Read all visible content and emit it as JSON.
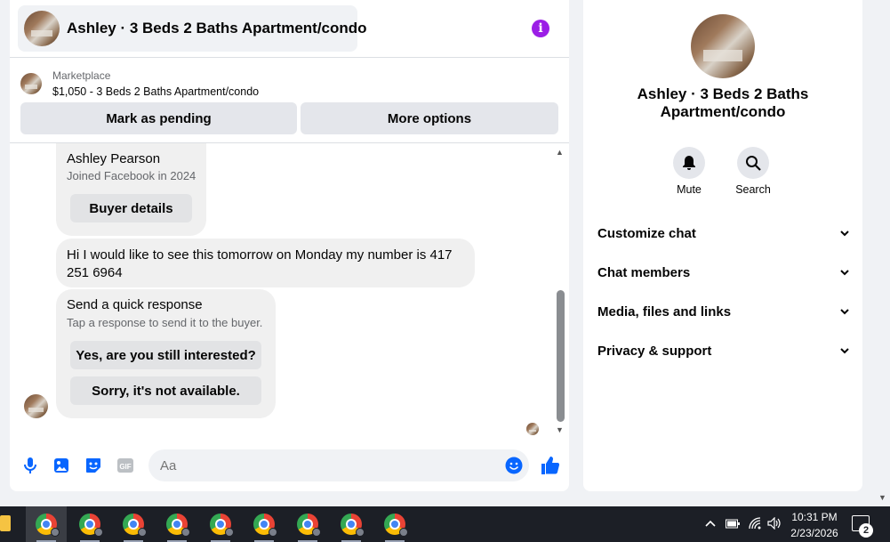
{
  "header": {
    "title": "Ashley · 3 Beds 2 Baths Apartment/condo",
    "info_icon": "info-icon",
    "info_glyph": "i",
    "info_color": "#9b1ee6"
  },
  "marketplace": {
    "label": "Marketplace",
    "listing": "$1,050 - 3 Beds 2 Baths Apartment/condo"
  },
  "actions": {
    "pending_label": "Mark as pending",
    "more_label": "More options"
  },
  "messages": {
    "buyer_card": {
      "name": "Ashley Pearson",
      "joined": "Joined Facebook in 2024",
      "details_button": "Buyer details"
    },
    "buyer_message": "Hi I would like to see this tomorrow on Monday my number is 417 251 6964",
    "quick_response": {
      "title": "Send a quick response",
      "subtitle": "Tap a response to send it to the buyer.",
      "options": [
        "Yes, are you still interested?",
        "Sorry, it's not available."
      ]
    }
  },
  "composer": {
    "placeholder": "Aa",
    "icons": [
      "microphone-icon",
      "image-icon",
      "sticker-icon",
      "gif-icon",
      "emoji-icon",
      "thumbs-up-icon"
    ],
    "gif_text": "GIF",
    "accent": "#0866ff"
  },
  "sidebar": {
    "title": "Ashley · 3 Beds 2 Baths Apartment/condo",
    "mute_label": "Mute",
    "search_label": "Search",
    "sections": [
      "Customize chat",
      "Chat members",
      "Media, files and links",
      "Privacy & support"
    ]
  },
  "taskbar": {
    "time": "10:31 PM",
    "date": "2/23/2026",
    "notification_count": "2",
    "app_count": 9
  }
}
